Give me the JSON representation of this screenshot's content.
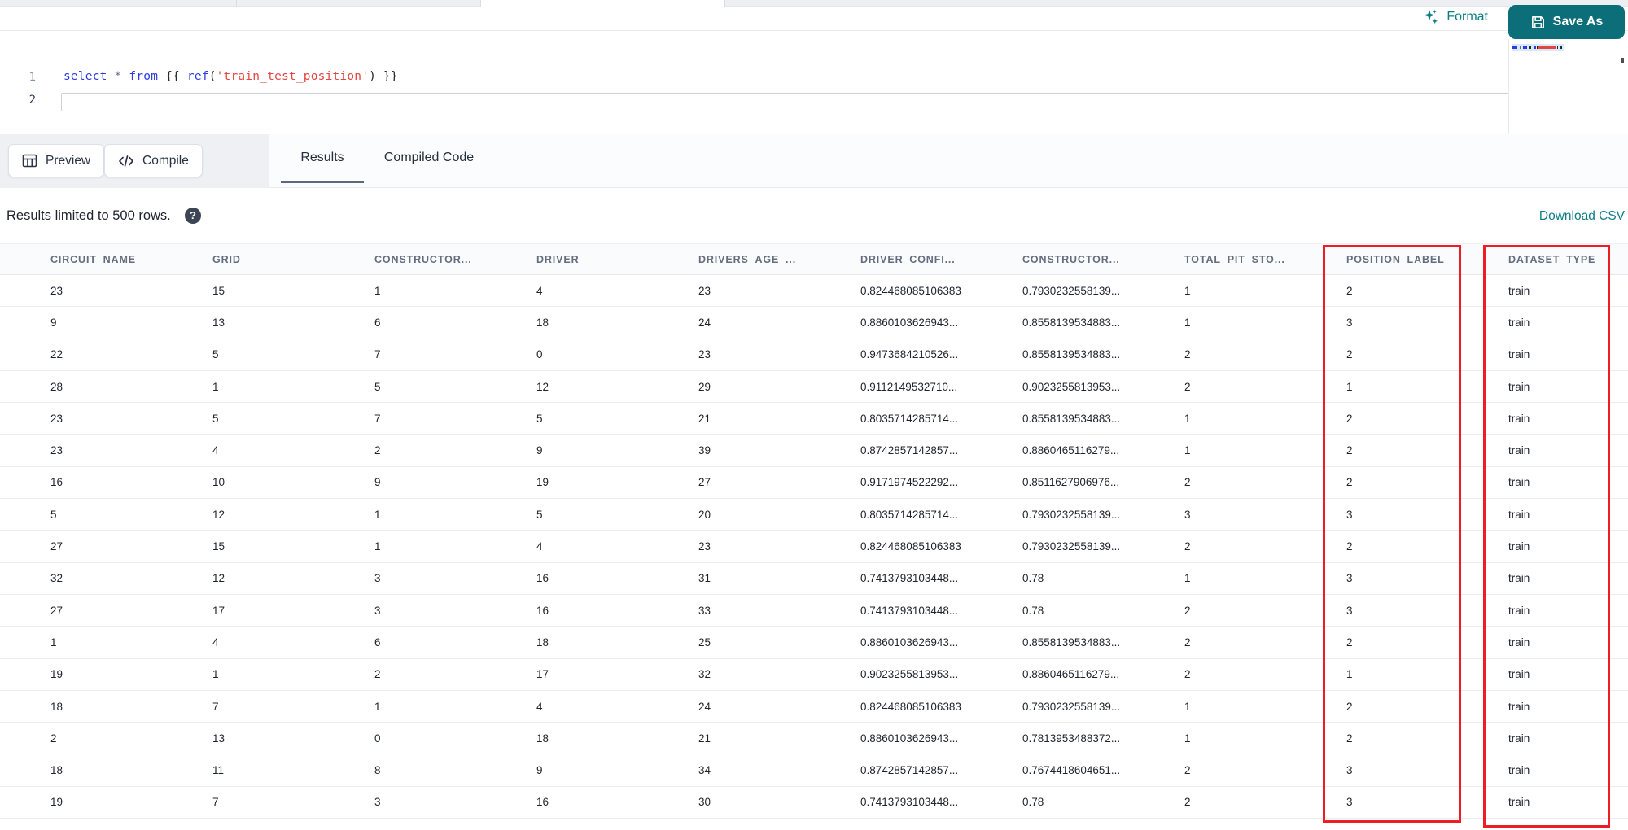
{
  "toolbar": {
    "format_label": "Format",
    "save_as_label": "Save As"
  },
  "editor": {
    "lines": [
      {
        "number": "1",
        "tokens": [
          {
            "t": "select",
            "c": "kw"
          },
          {
            "t": " ",
            "c": "pl"
          },
          {
            "t": "*",
            "c": "op"
          },
          {
            "t": " ",
            "c": "pl"
          },
          {
            "t": "from",
            "c": "kw"
          },
          {
            "t": " ",
            "c": "pl"
          },
          {
            "t": "{{",
            "c": "pl"
          },
          {
            "t": " ",
            "c": "pl"
          },
          {
            "t": "ref",
            "c": "fn"
          },
          {
            "t": "(",
            "c": "pl"
          },
          {
            "t": "'train_test_position'",
            "c": "str"
          },
          {
            "t": ")",
            "c": "pl"
          },
          {
            "t": " ",
            "c": "pl"
          },
          {
            "t": "}}",
            "c": "pl"
          }
        ]
      },
      {
        "number": "2",
        "tokens": []
      }
    ]
  },
  "actions": {
    "preview_label": "Preview",
    "compile_label": "Compile"
  },
  "tabs": [
    {
      "label": "Results",
      "active": true
    },
    {
      "label": "Compiled Code",
      "active": false
    }
  ],
  "results": {
    "limit_note": "Results limited to 500 rows.",
    "help_glyph": "?",
    "download_csv_label": "Download CSV"
  },
  "table": {
    "columns": [
      "CIRCUIT_NAME",
      "GRID",
      "CONSTRUCTOR...",
      "DRIVER",
      "DRIVERS_AGE_...",
      "DRIVER_CONFI...",
      "CONSTRUCTOR...",
      "TOTAL_PIT_STO...",
      "POSITION_LABEL",
      "DATASET_TYPE"
    ],
    "highlighted_columns": [
      "POSITION_LABEL",
      "DATASET_TYPE"
    ],
    "rows": [
      [
        "23",
        "15",
        "1",
        "4",
        "23",
        "0.824468085106383",
        "0.7930232558139...",
        "1",
        "2",
        "train"
      ],
      [
        "9",
        "13",
        "6",
        "18",
        "24",
        "0.8860103626943...",
        "0.8558139534883...",
        "1",
        "3",
        "train"
      ],
      [
        "22",
        "5",
        "7",
        "0",
        "23",
        "0.9473684210526...",
        "0.8558139534883...",
        "2",
        "2",
        "train"
      ],
      [
        "28",
        "1",
        "5",
        "12",
        "29",
        "0.9112149532710...",
        "0.9023255813953...",
        "2",
        "1",
        "train"
      ],
      [
        "23",
        "5",
        "7",
        "5",
        "21",
        "0.8035714285714...",
        "0.8558139534883...",
        "1",
        "2",
        "train"
      ],
      [
        "23",
        "4",
        "2",
        "9",
        "39",
        "0.8742857142857...",
        "0.8860465116279...",
        "1",
        "2",
        "train"
      ],
      [
        "16",
        "10",
        "9",
        "19",
        "27",
        "0.9171974522292...",
        "0.8511627906976...",
        "2",
        "2",
        "train"
      ],
      [
        "5",
        "12",
        "1",
        "5",
        "20",
        "0.8035714285714...",
        "0.7930232558139...",
        "3",
        "3",
        "train"
      ],
      [
        "27",
        "15",
        "1",
        "4",
        "23",
        "0.824468085106383",
        "0.7930232558139...",
        "2",
        "2",
        "train"
      ],
      [
        "32",
        "12",
        "3",
        "16",
        "31",
        "0.7413793103448...",
        "0.78",
        "1",
        "3",
        "train"
      ],
      [
        "27",
        "17",
        "3",
        "16",
        "33",
        "0.7413793103448...",
        "0.78",
        "2",
        "3",
        "train"
      ],
      [
        "1",
        "4",
        "6",
        "18",
        "25",
        "0.8860103626943...",
        "0.8558139534883...",
        "2",
        "2",
        "train"
      ],
      [
        "19",
        "1",
        "2",
        "17",
        "32",
        "0.9023255813953...",
        "0.8860465116279...",
        "2",
        "1",
        "train"
      ],
      [
        "18",
        "7",
        "1",
        "4",
        "24",
        "0.824468085106383",
        "0.7930232558139...",
        "1",
        "2",
        "train"
      ],
      [
        "2",
        "13",
        "0",
        "18",
        "21",
        "0.8860103626943...",
        "0.7813953488372...",
        "1",
        "2",
        "train"
      ],
      [
        "18",
        "11",
        "8",
        "9",
        "34",
        "0.8742857142857...",
        "0.7674418604651...",
        "2",
        "3",
        "train"
      ],
      [
        "19",
        "7",
        "3",
        "16",
        "30",
        "0.7413793103448...",
        "0.78",
        "2",
        "3",
        "train"
      ]
    ]
  },
  "colors": {
    "accent_teal": "#0e7d85",
    "save_button_teal": "#0b6e78",
    "highlight_red": "#ee1c25"
  }
}
